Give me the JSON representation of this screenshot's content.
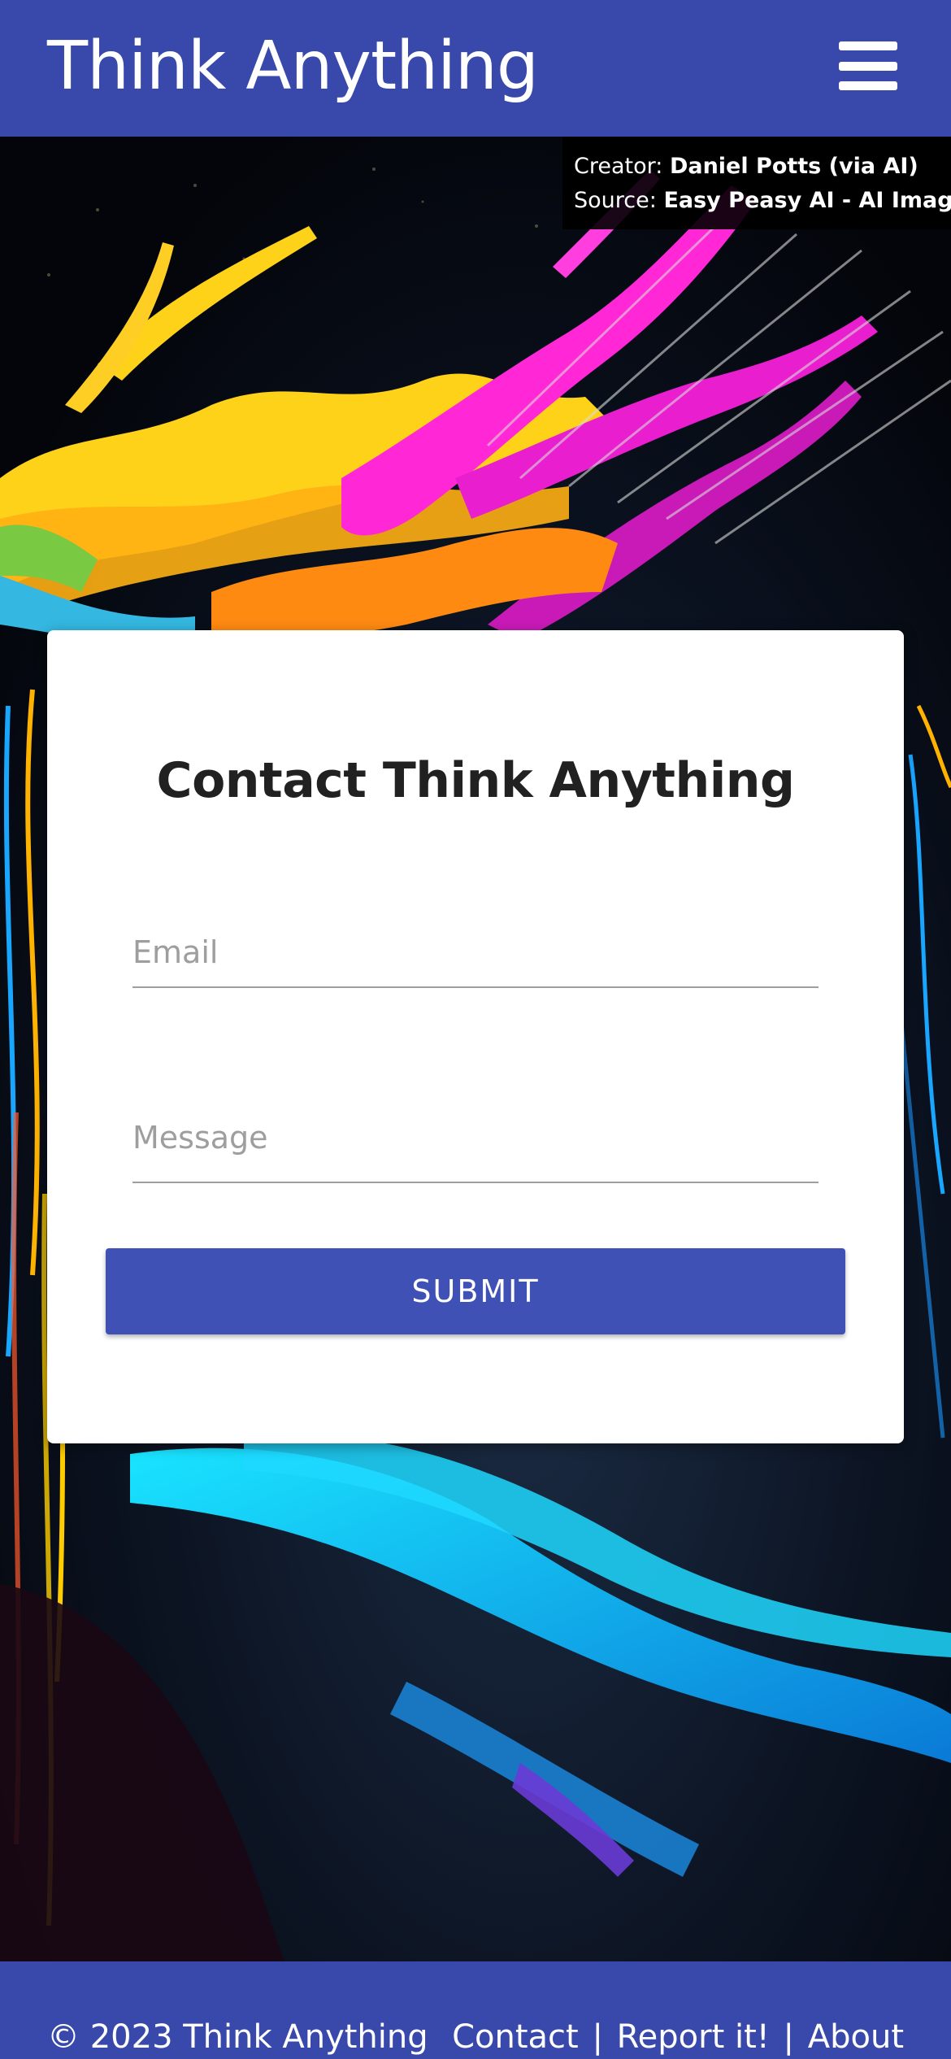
{
  "header": {
    "title": "Think Anything",
    "menu_icon": "hamburger-menu-icon"
  },
  "credit": {
    "creator_label": "Creator:",
    "creator_name": "Daniel Potts (via AI)",
    "source_label": "Source:",
    "source_name": "Easy Peasy AI - AI Images"
  },
  "contact": {
    "title_plain": "Contact",
    "title_bold": "Think Anything",
    "email_placeholder": "Email",
    "message_placeholder": "Message",
    "submit_label": "SUBMIT"
  },
  "footer": {
    "copyright": "© 2023 Think Anything",
    "links": [
      "Contact",
      "Report it!",
      "About"
    ],
    "separator": "|"
  },
  "colors": {
    "brand": "#3949ab",
    "button": "#3f51b5"
  }
}
